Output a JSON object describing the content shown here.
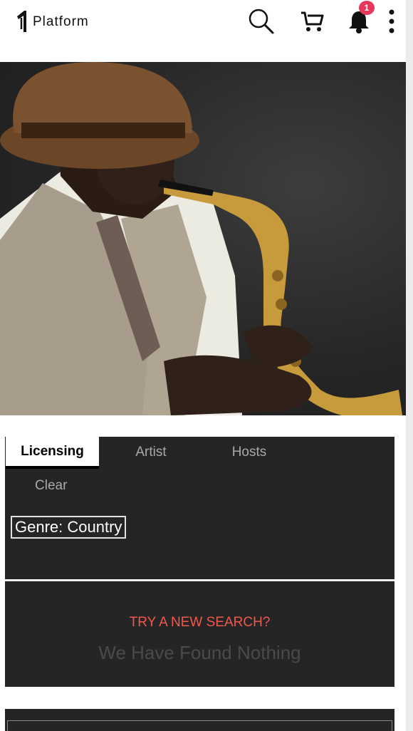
{
  "header": {
    "logo_text": "Platform",
    "notification_count": "1",
    "icons": [
      "logo-mark-icon",
      "search-icon",
      "cart-icon",
      "bell-icon",
      "more-vertical-icon"
    ]
  },
  "hero": {
    "description_icon": "saxophone-player-photo"
  },
  "search_panel": {
    "tabs": [
      {
        "label": "Licensing",
        "active": true
      },
      {
        "label": "Artist",
        "active": false
      },
      {
        "label": "Hosts",
        "active": false
      }
    ],
    "clear_label": "Clear",
    "filter_chip": "Genre: Country"
  },
  "results": {
    "prompt": "TRY A NEW SEARCH?",
    "empty_message": "We Have Found Nothing"
  },
  "colors": {
    "panel_bg": "#252527",
    "accent_red": "#f0584a",
    "badge": "#e8375a"
  }
}
